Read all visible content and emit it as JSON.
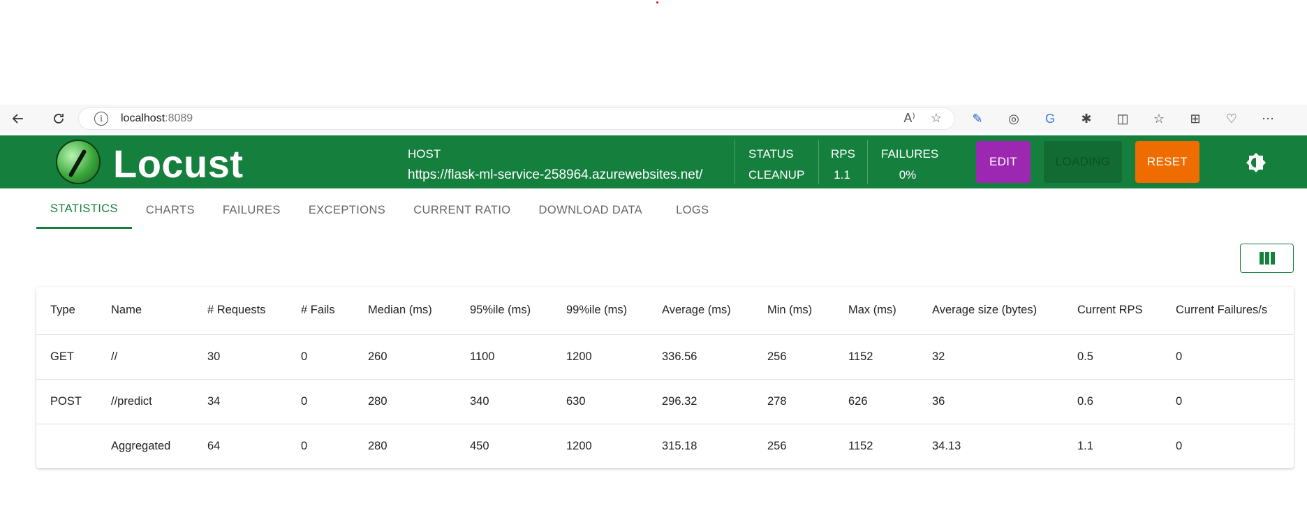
{
  "browser": {
    "url_host": "localhost",
    "url_port": ":8089"
  },
  "header": {
    "brand": "Locust",
    "host_label": "HOST",
    "host_value": "https://flask-ml-service-258964.azurewebsites.net/",
    "status_label": "STATUS",
    "status_value": "CLEANUP",
    "rps_label": "RPS",
    "rps_value": "1.1",
    "failures_label": "FAILURES",
    "failures_value": "0%",
    "edit_label": "EDIT",
    "loading_label": "LOADING",
    "reset_label": "RESET"
  },
  "tabs": [
    {
      "label": "STATISTICS"
    },
    {
      "label": "CHARTS"
    },
    {
      "label": "FAILURES"
    },
    {
      "label": "EXCEPTIONS"
    },
    {
      "label": "CURRENT RATIO"
    },
    {
      "label": "DOWNLOAD DATA"
    },
    {
      "label": "LOGS"
    }
  ],
  "table": {
    "columns": [
      "Type",
      "Name",
      "# Requests",
      "# Fails",
      "Median (ms)",
      "95%ile (ms)",
      "99%ile (ms)",
      "Average (ms)",
      "Min (ms)",
      "Max (ms)",
      "Average size (bytes)",
      "Current RPS",
      "Current Failures/s"
    ],
    "rows": [
      [
        "GET",
        "//",
        "30",
        "0",
        "260",
        "1100",
        "1200",
        "336.56",
        "256",
        "1152",
        "32",
        "0.5",
        "0"
      ],
      [
        "POST",
        "//predict",
        "34",
        "0",
        "280",
        "340",
        "630",
        "296.32",
        "278",
        "626",
        "36",
        "0.6",
        "0"
      ],
      [
        "",
        "Aggregated",
        "64",
        "0",
        "280",
        "450",
        "1200",
        "315.18",
        "256",
        "1152",
        "34.13",
        "1.1",
        "0"
      ]
    ]
  },
  "colors": {
    "header_green": "#15803d",
    "edit_purple": "#9c27b0",
    "reset_orange": "#ef6c00"
  }
}
